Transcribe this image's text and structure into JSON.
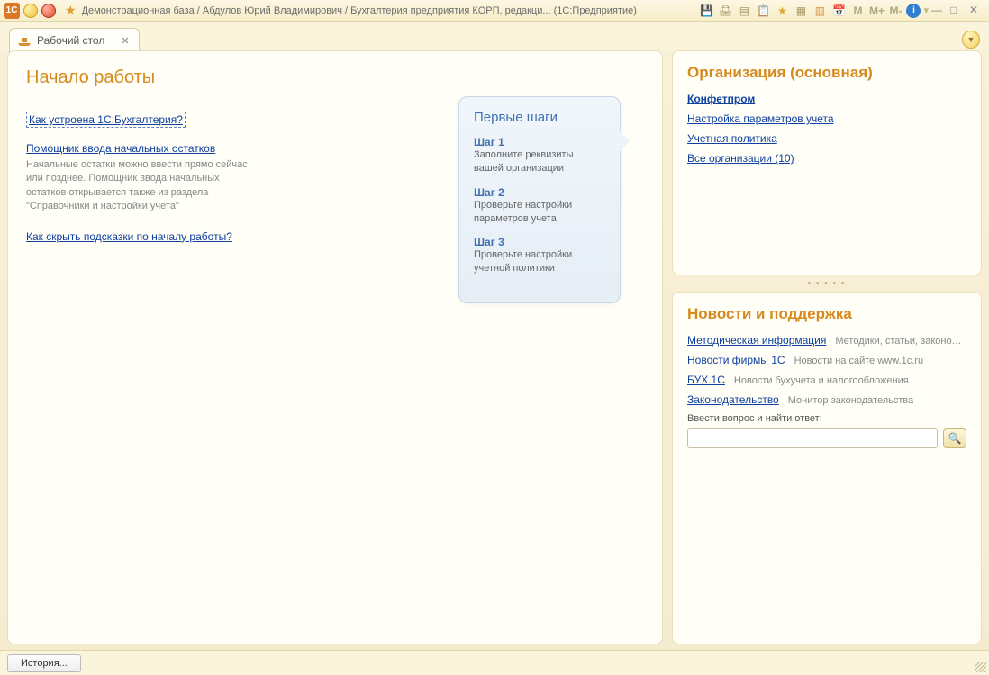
{
  "window": {
    "title": "Демонстрационная база / Абдулов Юрий Владимирович / Бухгалтерия предприятия КОРП, редакци...  (1С:Предприятие)"
  },
  "toolbar_icons": {
    "m": "M",
    "m_plus": "M+",
    "m_minus": "M-"
  },
  "tab": {
    "label": "Рабочий стол"
  },
  "main": {
    "title": "Начало работы",
    "link_how": "Как устроена 1С:Бухгалтерия?",
    "link_wizard": "Помощник ввода начальных остатков",
    "wizard_hint": "Начальные остатки можно ввести прямо сейчас или позднее. Помощник ввода начальных остатков открывается также из раздела \"Справочники и настройки учета\"",
    "link_hide_hints": "Как скрыть подсказки по началу работы?"
  },
  "bubble": {
    "title": "Первые шаги",
    "steps": [
      {
        "label": "Шаг 1",
        "text": "Заполните реквизиты вашей организации"
      },
      {
        "label": "Шаг 2",
        "text": "Проверьте настройки параметров учета"
      },
      {
        "label": "Шаг 3",
        "text": "Проверьте настройки учетной политики"
      }
    ]
  },
  "org": {
    "title": "Организация (основная)",
    "links": {
      "main": "Конфетпром",
      "params": "Настройка параметров учета",
      "policy": "Учетная политика",
      "all": "Все организации (10)"
    }
  },
  "news": {
    "title": "Новости и поддержка",
    "rows": [
      {
        "link": "Методическая информация",
        "desc": "Методики, статьи, законодате..."
      },
      {
        "link": "Новости фирмы 1С",
        "desc": "Новости на сайте www.1c.ru"
      },
      {
        "link": "БУХ.1С",
        "desc": "Новости бухучета и налогообложения"
      },
      {
        "link": "Законодательство",
        "desc": "Монитор законодательства"
      }
    ],
    "search_label": "Ввести вопрос и найти ответ:"
  },
  "bottombar": {
    "history": "История..."
  }
}
